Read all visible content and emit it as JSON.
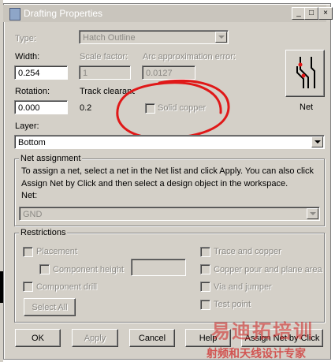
{
  "window": {
    "title": "Drafting Properties",
    "controls": [
      "_",
      "□",
      "×"
    ]
  },
  "type": {
    "label": "Type:",
    "value": "Hatch Outline"
  },
  "width": {
    "label": "Width:",
    "value": "0.254"
  },
  "scale_factor": {
    "label": "Scale factor:",
    "value": "1"
  },
  "arc_approx": {
    "label": "Arc approximation error:",
    "value": "0.0127"
  },
  "rotation": {
    "label": "Rotation:",
    "value": "0.000"
  },
  "track_clearance": {
    "label": "Track clearance:",
    "value": "0.2"
  },
  "solid_copper": {
    "label": "Solid copper",
    "checked": false
  },
  "net_icon": {
    "label": "Net"
  },
  "layer": {
    "label": "Layer:",
    "value": "Bottom"
  },
  "net_assignment": {
    "title": "Net assignment",
    "text_line1": "To assign a net, select a net in the Net list and click Apply. You can also click",
    "text_line2": "Assign Net by Click and then select a design object in the workspace.",
    "net_label": "Net:",
    "net_value": "GND"
  },
  "restrictions": {
    "title": "Restrictions",
    "placement": "Placement",
    "component_height": "Component height",
    "component_height_value": "",
    "component_drill": "Component drill",
    "select_all": "Select All",
    "trace_copper": "Trace and copper",
    "copper_pour": "Copper pour and plane area",
    "via_jumper": "Via and jumper",
    "test_point": "Test point"
  },
  "buttons": {
    "ok": "OK",
    "apply": "Apply",
    "cancel": "Cancel",
    "help": "Help",
    "assign_net": "Assign Net by Click"
  },
  "watermark": {
    "line1": "易迪拓培训",
    "line2": "射频和天线设计专家"
  },
  "colors": {
    "dialog_bg": "#d4d0c8",
    "annotation_red": "#e01818",
    "watermark_red": "#d02020"
  }
}
